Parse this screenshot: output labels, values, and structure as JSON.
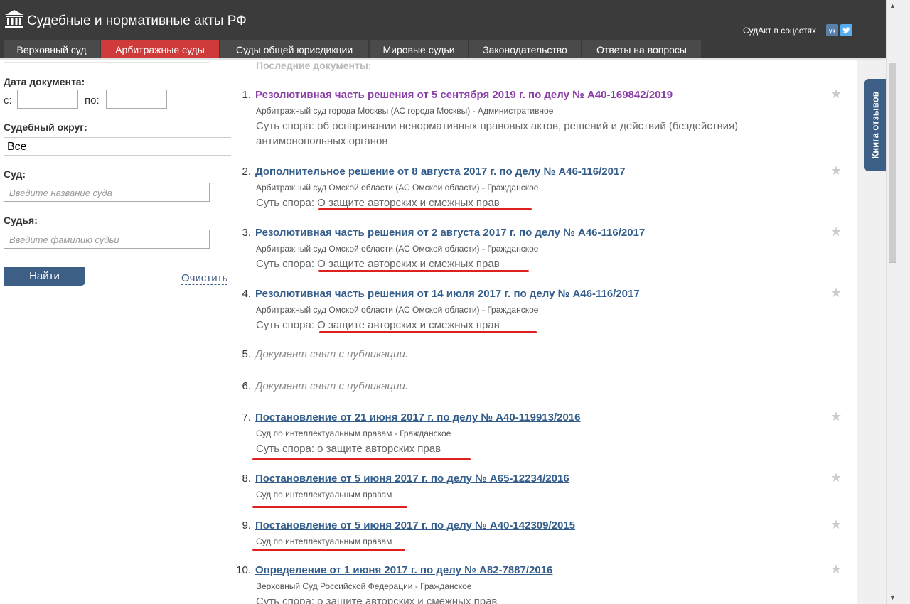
{
  "header": {
    "title": "Судебные и нормативные акты РФ",
    "logo_icon": "courthouse-icon",
    "social_label": "СудАкт в соцсетях",
    "social_vk": "vk",
    "social_twitter": "twitter-icon"
  },
  "nav": {
    "tabs": [
      {
        "label": "Верховный суд"
      },
      {
        "label": "Арбитражные суды"
      },
      {
        "label": "Суды общей юрисдикции"
      },
      {
        "label": "Мировые судьи"
      },
      {
        "label": "Законодательство"
      },
      {
        "label": "Ответы на вопросы"
      }
    ]
  },
  "filters": {
    "date_label": "Дата документа:",
    "from_label": "с:",
    "to_label": "по:",
    "from_value": "",
    "to_value": "",
    "district_label": "Судебный округ:",
    "district_value": "Все",
    "court_label": "Суд:",
    "court_placeholder": "Введите название суда",
    "judge_label": "Судья:",
    "judge_placeholder": "Введите фамилию судьи",
    "search_button": "Найти",
    "clear_link": "Очистить"
  },
  "content": {
    "latest_heading": "Последние документы:",
    "items": [
      {
        "num": "1.",
        "title": "Резолютивная часть решения от 5 сентября 2019 г. по делу № А40-169842/2019",
        "court": "Арбитражный суд города Москвы (АС города Москвы) - Административное",
        "dispute": "Суть спора: об оспаривании ненормативных правовых актов, решений и действий (бездействия) антимонопольных органов"
      },
      {
        "num": "2.",
        "title": "Дополнительное решение от 8 августа 2017 г. по делу № А46-116/2017",
        "court": "Арбитражный суд Омской области (АС Омской области) - Гражданское",
        "dispute": "Суть спора: О защите авторских и смежных прав"
      },
      {
        "num": "3.",
        "title": "Резолютивная часть решения от 2 августа 2017 г. по делу № А46-116/2017",
        "court": "Арбитражный суд Омской области (АС Омской области) - Гражданское",
        "dispute": "Суть спора: О защите авторских и смежных прав"
      },
      {
        "num": "4.",
        "title": "Резолютивная часть решения от 14 июля 2017 г. по делу № А46-116/2017",
        "court": "Арбитражный суд Омской области (АС Омской области) - Гражданское",
        "dispute": "Суть спора: О защите авторских и смежных прав"
      },
      {
        "num": "5.",
        "removed": "Документ снят с публикации."
      },
      {
        "num": "6.",
        "removed": "Документ снят с публикации."
      },
      {
        "num": "7.",
        "title": "Постановление от 21 июня 2017 г. по делу № А40-119913/2016",
        "court": "Суд по интеллектуальным правам - Гражданское",
        "dispute": "Суть спора: о защите авторских прав"
      },
      {
        "num": "8.",
        "title": "Постановление от 5 июня 2017 г. по делу № А65-12234/2016",
        "court": "Суд по интеллектуальным правам"
      },
      {
        "num": "9.",
        "title": "Постановление от 5 июня 2017 г. по делу № А40-142309/2015",
        "court": "Суд по интеллектуальным правам"
      },
      {
        "num": "10.",
        "title": "Определение от 1 июня 2017 г. по делу № А82-7887/2016",
        "court": "Верховный Суд Российской Федерации - Гражданское",
        "dispute": "Суть спора: о защите авторских и смежных прав"
      }
    ]
  },
  "feedback_tab": "Книга отзывов",
  "colors": {
    "header_bg": "#3b3b3b",
    "active_tab": "#cf3a3a",
    "link": "#335d8b",
    "visited_link": "#8a3ea6",
    "annotation": "#e02020"
  }
}
